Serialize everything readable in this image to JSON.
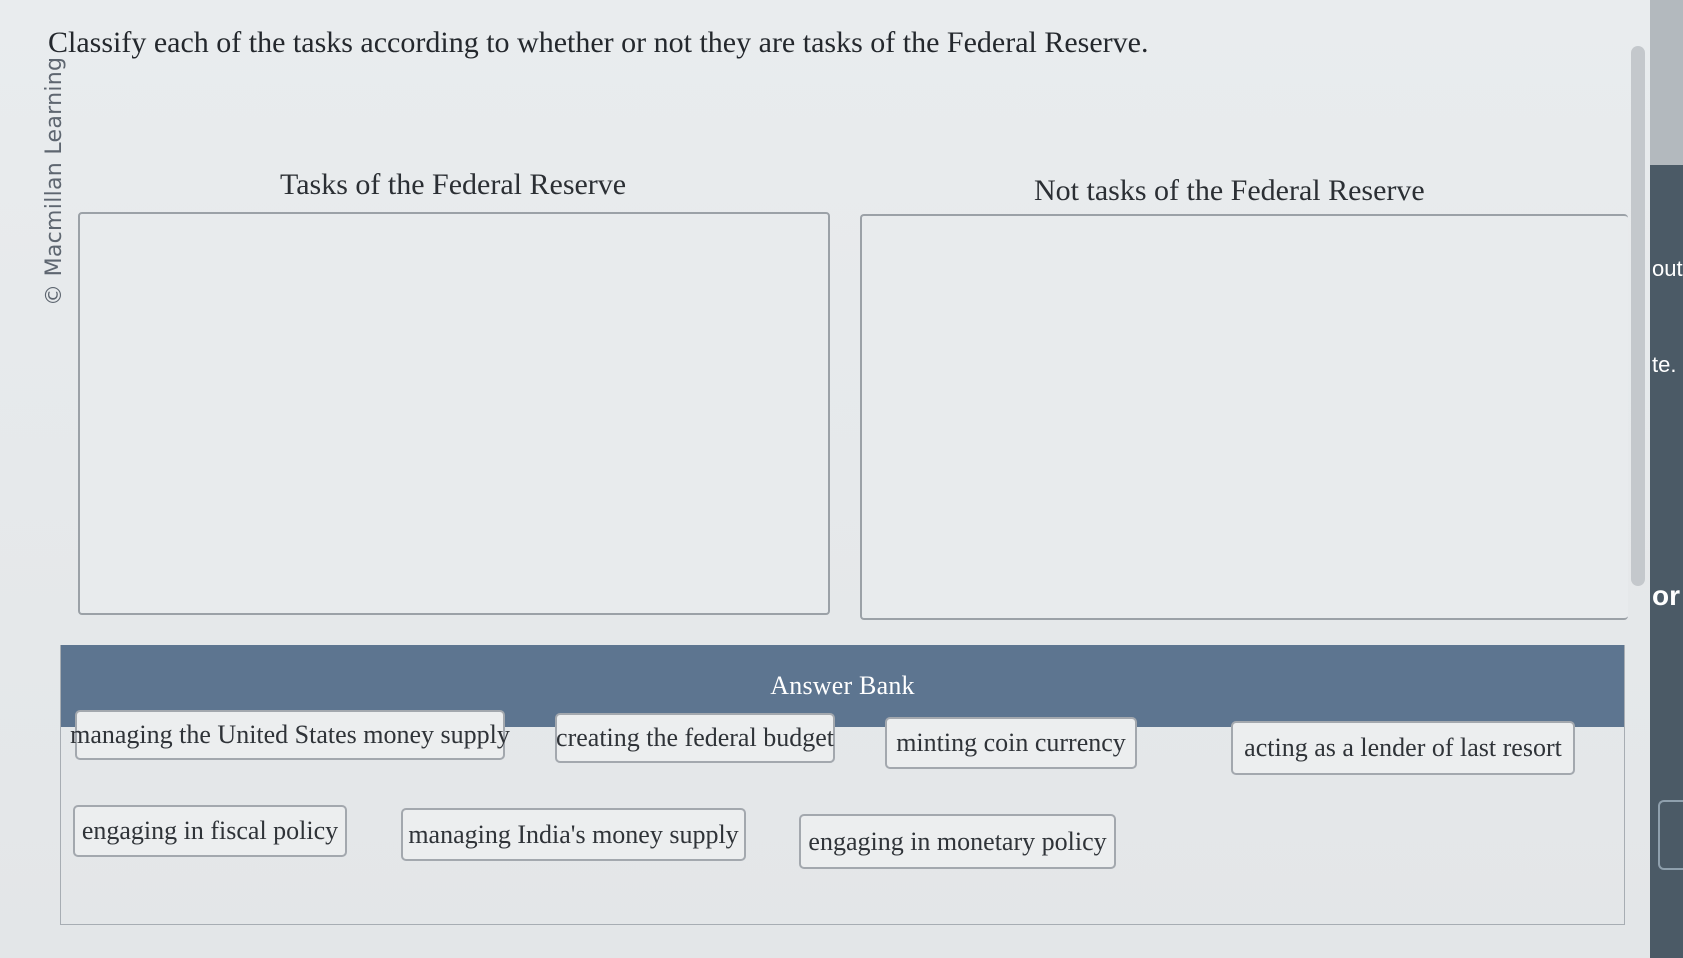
{
  "question": {
    "text": "Classify each of the tasks according to whether or not they are tasks of the Federal Reserve."
  },
  "watermark": "© Macmillan Learning",
  "bins": {
    "left_title": "Tasks of the Federal Reserve",
    "right_title": "Not tasks of the Federal Reserve"
  },
  "answer_bank": {
    "title": "Answer Bank",
    "items": [
      "managing the United States money supply",
      "creating the federal budget",
      "minting coin currency",
      "acting as a lender of last resort",
      "engaging in fiscal policy",
      "managing India's money supply",
      "engaging in monetary policy"
    ]
  },
  "side_strip": {
    "text_1": "out",
    "text_2": "te.",
    "text_3": "or"
  }
}
